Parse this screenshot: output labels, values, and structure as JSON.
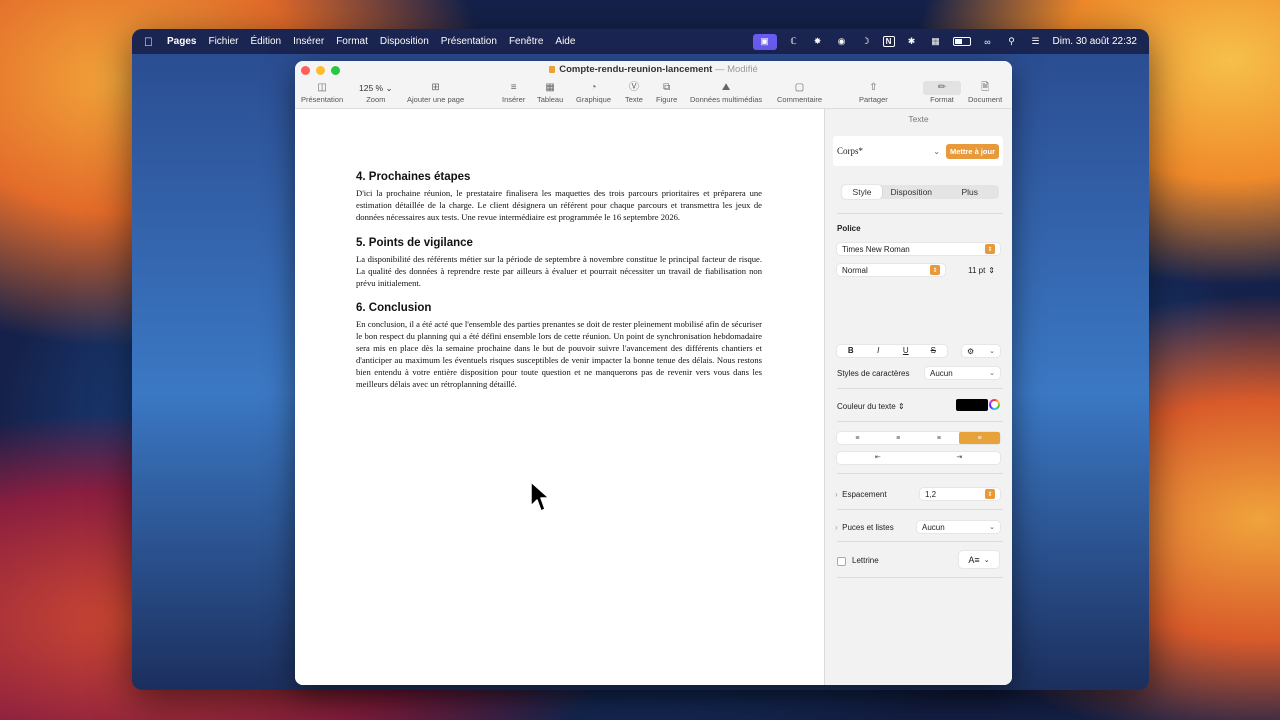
{
  "menubar": {
    "app_name": "Pages",
    "menus": [
      "Fichier",
      "Édition",
      "Insérer",
      "Format",
      "Disposition",
      "Présentation",
      "Fenêtre",
      "Aide"
    ],
    "clock": "Dim. 30 août  22:32",
    "status_icons": [
      "screen-mirroring-icon",
      "script-icon",
      "brightness-icon",
      "siri-icon",
      "moon-icon",
      "notion-icon",
      "bluetooth-icon",
      "keyboard-icon",
      "battery-icon",
      "link-icon",
      "search-icon",
      "control-center-icon"
    ]
  },
  "window": {
    "doc_name": "Compte-rendu-reunion-lancement",
    "doc_status": "— Modifié",
    "toolbar": {
      "presentation": "Présentation",
      "zoom_value": "125 %",
      "zoom": "Zoom",
      "add_page": "Ajouter une page",
      "insert": "Insérer",
      "table": "Tableau",
      "chart": "Graphique",
      "text": "Texte",
      "shape": "Figure",
      "media": "Données multimédias",
      "comment": "Commentaire",
      "share": "Partager",
      "format": "Format",
      "document": "Document"
    }
  },
  "document": {
    "sections": [
      {
        "heading": "4. Prochaines étapes",
        "body": "D'ici la prochaine réunion, le prestataire finalisera les maquettes des trois parcours prioritaires et préparera une estimation détaillée de la charge. Le client désignera un référent pour chaque parcours et transmettra les jeux de données nécessaires aux tests. Une revue intermédiaire est programmée le 16 septembre 2026."
      },
      {
        "heading": "5. Points de vigilance",
        "body": "La disponibilité des référents métier sur la période de septembre à novembre constitue le principal facteur de risque. La qualité des données à reprendre reste par ailleurs à évaluer et pourrait nécessiter un travail de fiabilisation non prévu initialement."
      },
      {
        "heading": "6. Conclusion",
        "body": "En conclusion, il a été acté que l'ensemble des parties prenantes se doit de rester pleinement mobilisé afin de sécuriser le bon respect du planning qui a été défini ensemble lors de cette réunion. Un point de synchronisation hebdomadaire sera mis en place dès la semaine prochaine dans le but de pouvoir suivre l'avancement des différents chantiers et d'anticiper au maximum les éventuels risques susceptibles de venir impacter la bonne tenue des délais. Nous restons bien entendu à votre entière disposition pour toute question et ne manquerons pas de revenir vers vous dans les meilleurs délais avec un rétroplanning détaillé."
      }
    ]
  },
  "inspector": {
    "title": "Texte",
    "paragraph_style": "Corps*",
    "update_button": "Mettre à jour",
    "tabs": [
      "Style",
      "Disposition",
      "Plus"
    ],
    "font_label": "Police",
    "font_family": "Times New Roman",
    "font_weight": "Normal",
    "font_size": "11 pt",
    "bold": "B",
    "italic": "I",
    "underline": "U",
    "strike": "S",
    "char_styles_label": "Styles de caractères",
    "char_styles_value": "Aucun",
    "text_color_label": "Couleur du texte",
    "text_color": "#000000",
    "spacing_label": "Espacement",
    "spacing_value": "1,2",
    "bullets_label": "Puces et listes",
    "bullets_value": "Aucun",
    "dropcap_label": "Lettrine",
    "accent_color": "#e89a3a"
  }
}
